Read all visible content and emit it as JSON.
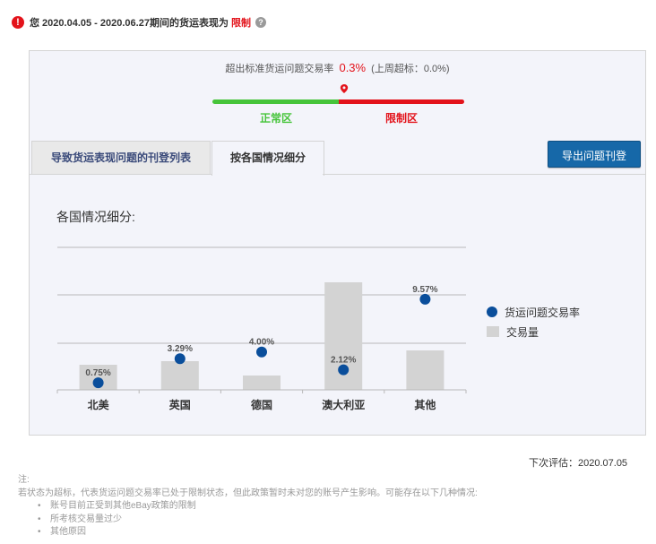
{
  "header": {
    "alert_icon": "exclamation-icon",
    "status_prefix": "您 2020.04.05 - 2020.06.27期间的货运表现为",
    "status_value": "限制",
    "help_icon": "question-icon"
  },
  "gauge": {
    "rate_label": "超出标准货运问题交易率",
    "rate_value": "0.3%",
    "last_week": "(上周超标：0.0%)",
    "zone_normal": "正常区",
    "zone_restricted": "限制区",
    "marker_icon": "location-pin-icon",
    "colors": {
      "normal": "#46c43a",
      "restricted": "#e3131b"
    }
  },
  "tabs": [
    {
      "label": "导致货运表现问题的刊登列表",
      "active": false
    },
    {
      "label": "按各国情况细分",
      "active": true
    }
  ],
  "export_button": "导出问题刊登",
  "chart_title": "各国情况细分:",
  "chart_data": {
    "type": "bar",
    "categories": [
      "北美",
      "英国",
      "德国",
      "澳大利亚",
      "其他"
    ],
    "series": [
      {
        "name": "交易量",
        "type": "bar",
        "values": [
          28,
          32,
          16,
          120,
          44
        ]
      },
      {
        "name": "货运问题交易率",
        "type": "scatter",
        "values": [
          0.75,
          3.29,
          4.0,
          2.12,
          9.57
        ],
        "labels": [
          "0.75%",
          "3.29%",
          "4.00%",
          "2.12%",
          "9.57%"
        ]
      }
    ],
    "colors": {
      "bar": "#d3d3d3",
      "dot": "#0a4e9b"
    },
    "grid": true,
    "legend": "right"
  },
  "legend": [
    {
      "label": "货运问题交易率",
      "icon": "dot"
    },
    {
      "label": "交易量",
      "icon": "box"
    }
  ],
  "next_eval": "下次评估：2020.07.05",
  "notes": {
    "title": "注:",
    "body": "若状态为超标，代表货运问题交易率已处于限制状态，但此政策暂时未对您的账号产生影响。可能存在以下几种情况:",
    "items": [
      "账号目前正受到其他eBay政策的限制",
      "所考核交易量过少",
      "其他原因"
    ]
  }
}
